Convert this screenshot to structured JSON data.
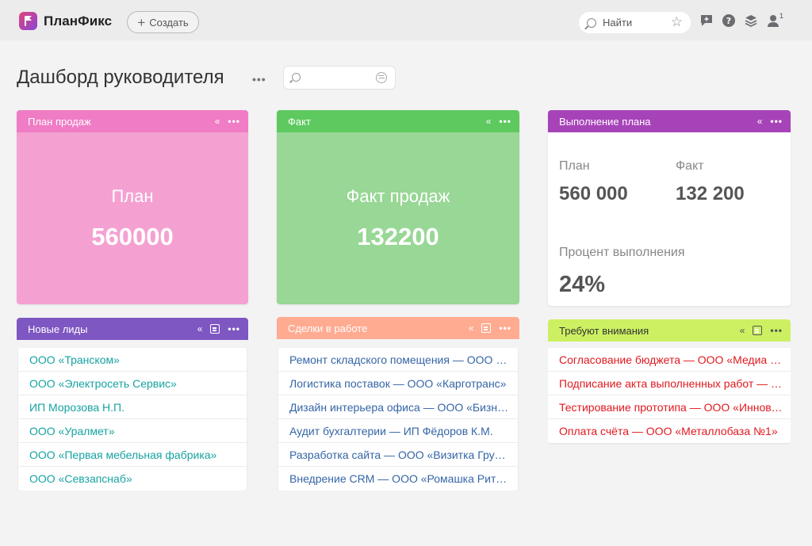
{
  "app": {
    "name": "ПланФикс",
    "create_label": "Создать",
    "search_placeholder": "Найти",
    "notifications_count": "1"
  },
  "page": {
    "title": "Дашборд руководителя",
    "filter_placeholder": ""
  },
  "colors": {
    "pink_head": "#ef7cc4",
    "pink_body": "#f4a1d2",
    "green_head": "#5dc95f",
    "green_body": "#98d795",
    "purple_head": "#a743b9",
    "violet_head": "#7e57c2",
    "salmon_head": "#ffab91",
    "lime_head": "#ccf062"
  },
  "widgets": {
    "plan_sales": {
      "title": "План продаж",
      "label": "План",
      "value": "560000"
    },
    "fact": {
      "title": "Факт",
      "label": "Факт продаж",
      "value": "132200"
    },
    "plan_execution": {
      "title": "Выполнение плана",
      "plan_label": "План",
      "plan_value": "560 000",
      "fact_label": "Факт",
      "fact_value": "132 200",
      "percent_label": "Процент выполнения",
      "percent_value": "24%"
    },
    "new_leads": {
      "title": "Новые лиды",
      "items": [
        "ООО «Транском»",
        "ООО «Электросеть Сервис»",
        "ИП Морозова Н.П.",
        "ООО «Уралмет»",
        "ООО «Первая мебельная фабрика»",
        "ООО «Севзапснаб»"
      ]
    },
    "deals": {
      "title": "Сделки в работе",
      "items": [
        "Ремонт складского помещения — ООО «Стройресурс»",
        "Логистика поставок — ООО «Карготранс»",
        "Дизайн интерьера офиса — ООО «Бизнес Центр»",
        "Аудит бухгалтерии — ИП Фёдоров К.М.",
        "Разработка сайта — ООО «Визитка Групп»",
        "Внедрение CRM — ООО «Ромашка Ритейл»"
      ]
    },
    "attention": {
      "title": "Требуют внимания",
      "items": [
        "Согласование бюджета — ООО «Медиа Плюс»",
        "Подписание акта выполненных работ — ООО «Альфа»",
        "Тестирование прототипа — ООО «Инновации»",
        "Оплата счёта — ООО «Металлобаза №1»"
      ]
    }
  }
}
